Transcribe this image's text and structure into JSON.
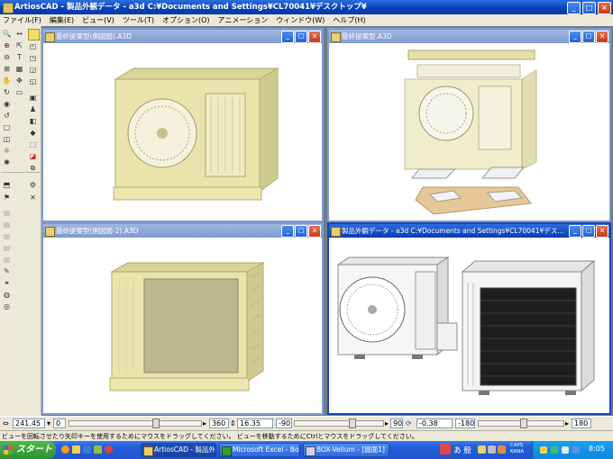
{
  "app_title": "ArtiosCAD - 製品外観データ - a3d C:¥Documents and Settings¥CL70041¥デスクトップ¥",
  "title_buttons": {
    "minimize": "_",
    "maximize": "□",
    "close": "×"
  },
  "menu": [
    "ファイル(F)",
    "編集(E)",
    "ビュー(V)",
    "ツール(T)",
    "オプション(O)",
    "アニメーション",
    "ウィンドウ(W)",
    "ヘルプ(H)"
  ],
  "windows": [
    {
      "title": "最終提案型(側図図).A3D"
    },
    {
      "title": "最終提案型.A3D"
    },
    {
      "title": "最終提案型(側図図-2).A3D"
    },
    {
      "title": "製品外観データ - a3d C:¥Documents and Settings¥CL70041¥デス..."
    }
  ],
  "controls": {
    "value1": "241.45",
    "value2": "0",
    "value3": "360",
    "value4": "16.35",
    "value5": "-90",
    "value6": "90",
    "value7": "-0.38",
    "value8": "-180",
    "value9": "180"
  },
  "status_text": "ビューを回転させたり矢印キーを使用するためにマウスをドラッグしてください。 ビューを移動するためにCtrlとマウスをドラッグしてください。",
  "taskbar": {
    "start_label": "スタート",
    "tasks": [
      {
        "label": "ArtiosCAD - 製品外..."
      },
      {
        "label": "Microsoft Excel - Bo..."
      },
      {
        "label": "BOX-Vellum - [図面1]"
      }
    ],
    "ime": "あ 般",
    "caps": "CAPS",
    "kana": "KANA",
    "clock": "8:05"
  },
  "colors": {
    "titlebar": "#0b3cb0",
    "unit_body": "#e6e2a8",
    "inactive_title": "#8aa5d8",
    "mdi_background": "#6e7b8c"
  }
}
